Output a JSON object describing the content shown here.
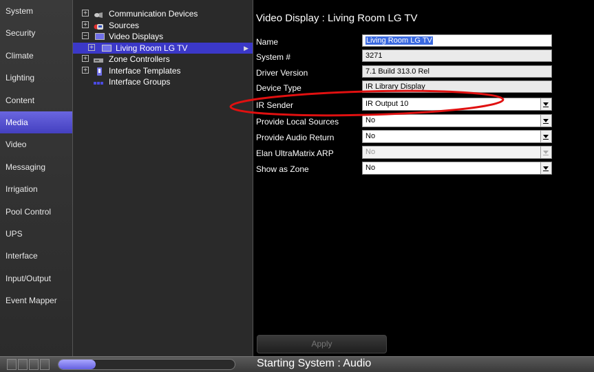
{
  "nav": {
    "items": [
      {
        "label": "System"
      },
      {
        "label": "Security"
      },
      {
        "label": "Climate"
      },
      {
        "label": "Lighting"
      },
      {
        "label": "Content"
      },
      {
        "label": "Media",
        "active": true
      },
      {
        "label": "Video"
      },
      {
        "label": "Messaging"
      },
      {
        "label": "Irrigation"
      },
      {
        "label": "Pool Control"
      },
      {
        "label": "UPS"
      },
      {
        "label": "Interface"
      },
      {
        "label": "Input/Output"
      },
      {
        "label": "Event Mapper"
      }
    ]
  },
  "tree": {
    "items": [
      {
        "label": "Communication Devices",
        "expander": "+",
        "icon": "communication-icon"
      },
      {
        "label": "Sources",
        "expander": "+",
        "icon": "sources-icon"
      },
      {
        "label": "Video Displays",
        "expander": "−",
        "icon": "display-icon"
      },
      {
        "label": "Living Room LG TV",
        "expander": "+",
        "icon": "display-icon",
        "selected": true
      },
      {
        "label": "Zone Controllers",
        "expander": "+",
        "icon": "zone-controller-icon"
      },
      {
        "label": "Interface Templates",
        "expander": "+",
        "icon": "template-icon"
      },
      {
        "label": "Interface Groups",
        "expander": "",
        "icon": "groups-icon"
      }
    ]
  },
  "main": {
    "title": "Video Display : Living Room LG TV",
    "props": {
      "name": {
        "label": "Name",
        "value": "Living Room LG TV"
      },
      "system_num": {
        "label": "System #",
        "value": "3271"
      },
      "driver_version": {
        "label": "Driver Version",
        "value": "7.1 Build 313.0 Rel"
      },
      "device_type": {
        "label": "Device Type",
        "value": "IR Library Display"
      },
      "ir_sender": {
        "label": "IR Sender",
        "value": "IR Output 10"
      },
      "local_sources": {
        "label": "Provide Local Sources",
        "value": "No"
      },
      "audio_return": {
        "label": "Provide Audio Return",
        "value": "No"
      },
      "ultramatrix_arp": {
        "label": "Elan UltraMatrix ARP",
        "value": "No"
      },
      "show_as_zone": {
        "label": "Show as Zone",
        "value": "No"
      }
    },
    "apply_label": "Apply"
  },
  "status": {
    "text": "Starting System : Audio",
    "progress": 0.21
  },
  "colors": {
    "accent": "#4a46d0",
    "selection": "#3b38c8",
    "highlight_ellipse": "#e01010"
  }
}
